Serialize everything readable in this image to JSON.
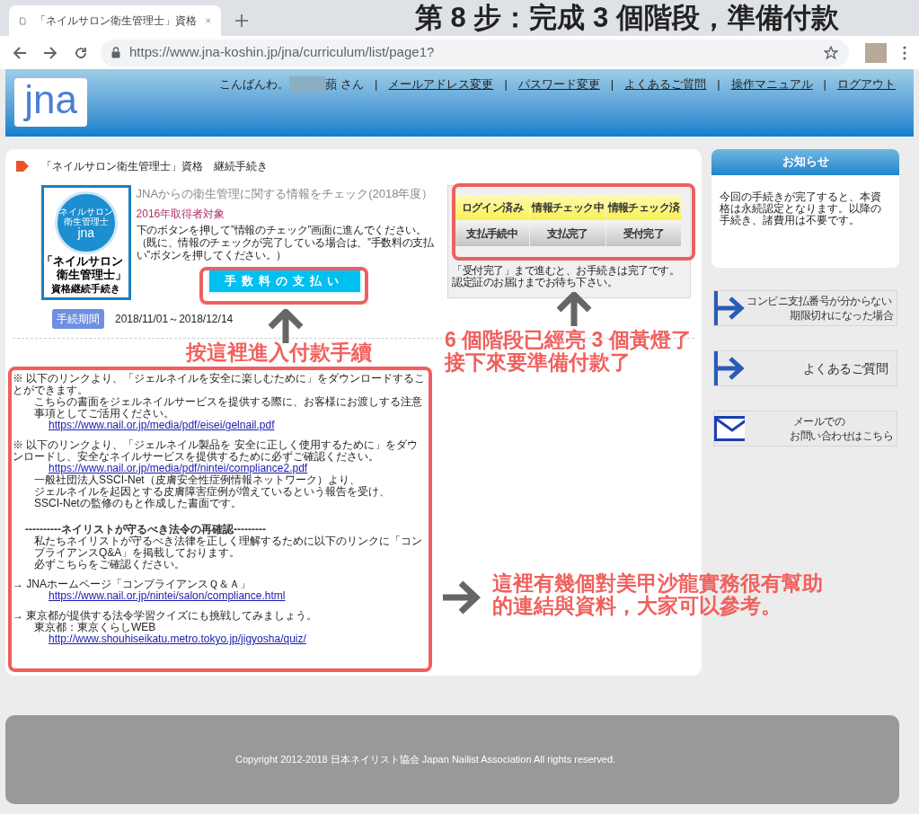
{
  "browser": {
    "tab_title": "「ネイルサロン衛生管理士」資格",
    "url": "https://www.jna-koshin.jp/jna/curriculum/list/page1?"
  },
  "header": {
    "logo": "jna",
    "greeting": "こんばんわ。",
    "user_suffix": "蘋 さん",
    "links": [
      {
        "separator": "|",
        "label": "メールアドレス変更"
      },
      {
        "separator": "|",
        "label": "パスワード変更"
      },
      {
        "separator": "|",
        "label": "よくあるご質問"
      },
      {
        "separator": "|",
        "label": "操作マニュアル"
      },
      {
        "separator": "|",
        "label": "ログアウト"
      }
    ]
  },
  "procedure": {
    "heading": "「ネイルサロン衛生管理士」資格　継続手続き",
    "badge": {
      "circle_lines": [
        "ネイルサロン",
        "衛生管理士",
        "jna"
      ],
      "title_lines": [
        "「ネイルサロン",
        "衛生管理士」"
      ],
      "subtitle": "資格継続手続き"
    },
    "title": "JNAからの衛生管理に関する情報をチェック(2018年度）",
    "target": "2016年取得者対象",
    "description": [
      "下のボタンを押して”情報のチェック”画面に進んでください。",
      "（既に、情報のチェックが完了している場合は、”手数料の支払い”ボタンを押してください。）"
    ],
    "pay_button": "手数料の支払い",
    "stages": [
      {
        "label": "ログイン済み",
        "lit": true
      },
      {
        "label": "情報チェック中",
        "lit": true
      },
      {
        "label": "情報チェック済",
        "lit": true
      },
      {
        "label": "支払手続中",
        "lit": false
      },
      {
        "label": "支払完了",
        "lit": false
      },
      {
        "label": "受付完了",
        "lit": false
      }
    ],
    "stage_note": [
      "「受付完了」まで進むと、お手続きは完了です。",
      "認定証のお届けまでお待ち下さい。"
    ],
    "period_label": "手続期間",
    "period": "2018/11/01～2018/12/14"
  },
  "links": [
    {
      "kind": "text",
      "text": "※ 以下のリンクより、「ジェルネイルを安全に楽しむために」をダウンロードすることができます。"
    },
    {
      "kind": "subtext",
      "text": "こちらの書面をジェルネイルサービスを提供する際に、お客様にお渡しする注意事項としてご活用ください。"
    },
    {
      "kind": "link",
      "text": "https://www.nail.or.jp/media/pdf/eisei/gelnail.pdf"
    },
    {
      "kind": "text",
      "text": "※ 以下のリンクより、「ジェルネイル製品を 安全に正しく使用するために」をダウンロードし、安全なネイルサービスを提供するために必ずご確認ください。",
      "gap": true
    },
    {
      "kind": "link",
      "text": "https://www.nail.or.jp/media/pdf/nintei/compliance2.pdf"
    },
    {
      "kind": "subtext",
      "text": "一般社団法人SSCI-Net（皮膚安全性症例情報ネットワーク）より、"
    },
    {
      "kind": "subtext",
      "text": "ジェルネイルを起因とする皮膚障害症例が増えているという報告を受け、"
    },
    {
      "kind": "subtext",
      "text": "SSCI-Netの監修のもと作成した書面です。"
    },
    {
      "kind": "heading",
      "text": "----------ネイリストが守るべき法令の再確認---------"
    },
    {
      "kind": "subtext",
      "text": "私たちネイリストが守るべき法律を正しく理解するために以下のリンクに「コンプライアンスQ&A」を掲載しております。"
    },
    {
      "kind": "subtext",
      "text": "必ずこちらをご確認ください。"
    },
    {
      "kind": "text",
      "text": "→ JNAホームページ「コンプライアンスＱ＆Ａ」",
      "gap": true
    },
    {
      "kind": "link",
      "text": "https://www.nail.or.jp/nintei/salon/compliance.html"
    },
    {
      "kind": "text",
      "text": "→ 東京都が提供する法令学習クイズにも挑戦してみましょう。",
      "gap": true
    },
    {
      "kind": "subtext",
      "text": "東京都：東京くらしWEB"
    },
    {
      "kind": "link",
      "text": "http://www.shouhiseikatu.metro.tokyo.jp/jigyosha/quiz/"
    }
  ],
  "sidebar": {
    "notice_title": "お知らせ",
    "notice_text": "今回の手続きが完了すると、本資格は永続認定となります。以降の手続き、諸費用は不要です。",
    "banners": [
      {
        "kind": "arrow",
        "lines": [
          "コンビニ支払番号が分からない",
          "期限切れになった場合"
        ]
      },
      {
        "kind": "arrow",
        "lines": [
          "よくあるご質問"
        ]
      },
      {
        "kind": "mail",
        "lines": [
          "メールでの",
          "お問い合わせはこちら"
        ]
      }
    ]
  },
  "footer": "Copyright 2012-2018 日本ネイリスト協会 Japan Nailist Association All rights reserved.",
  "annotations": {
    "title": "第 8 步：完成 3 個階段，準備付款",
    "callouts": [
      {
        "kind": "up",
        "lines": [
          "按這裡進入付款手續"
        ]
      },
      {
        "kind": "up",
        "lines": [
          "6 個階段已經亮 3 個黃燈了",
          "接下來要準備付款了"
        ]
      },
      {
        "kind": "right",
        "lines": [
          "這裡有幾個對美甲沙龍實務很有幫助",
          "的連結與資料，大家可以參考。"
        ]
      }
    ]
  }
}
